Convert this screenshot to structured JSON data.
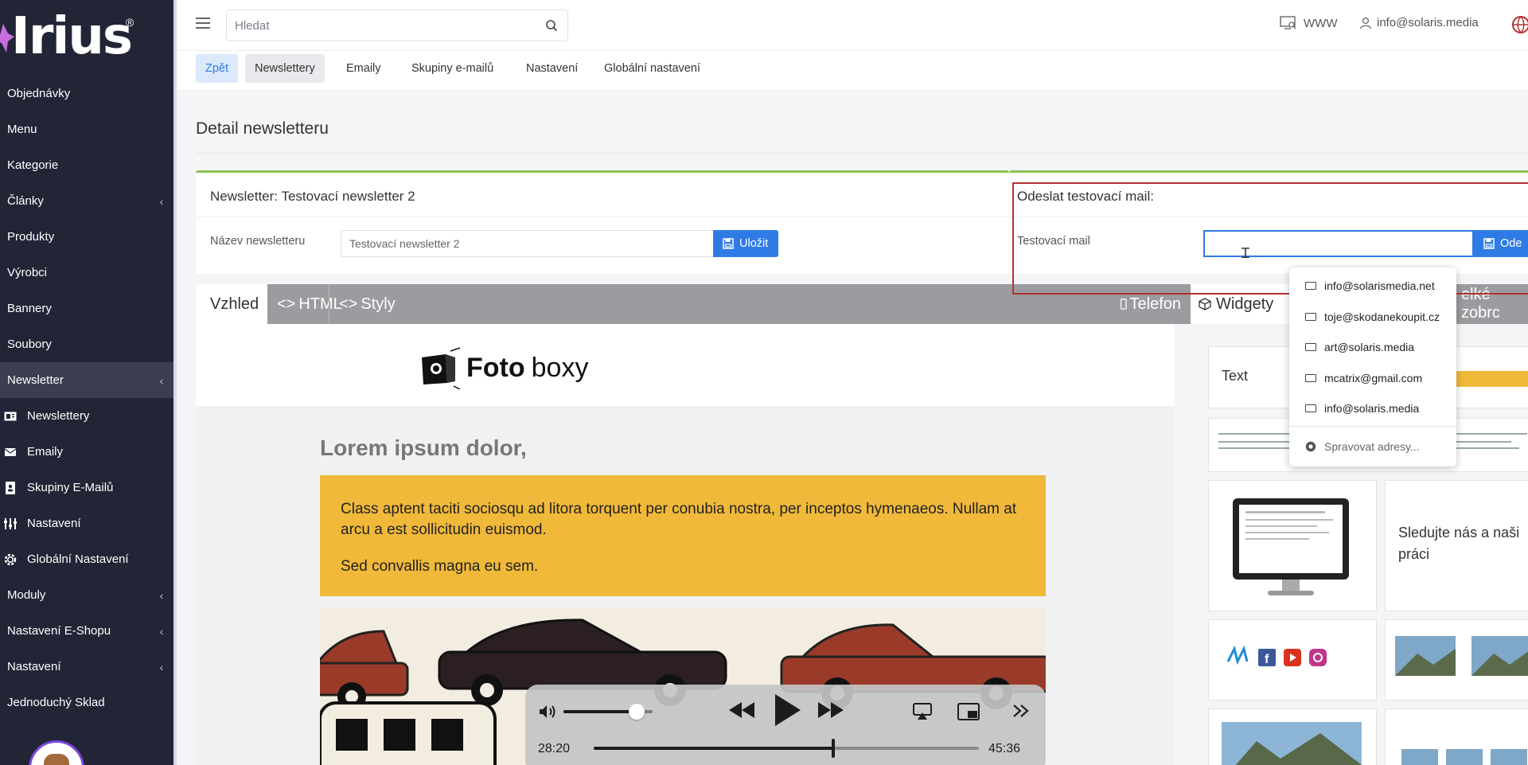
{
  "sidebar": {
    "logo_text": "Irius",
    "logo_mark": "®",
    "items": [
      {
        "label": "Objednávky",
        "chevron": false
      },
      {
        "label": "Menu",
        "chevron": false
      },
      {
        "label": "Kategorie",
        "chevron": false
      },
      {
        "label": "Články",
        "chevron": true
      },
      {
        "label": "Produkty",
        "chevron": false
      },
      {
        "label": "Výrobci",
        "chevron": false
      },
      {
        "label": "Bannery",
        "chevron": false
      },
      {
        "label": "Soubory",
        "chevron": false
      },
      {
        "label": "Newsletter",
        "chevron": true,
        "active": true
      }
    ],
    "sub_items": [
      {
        "label": "Newslettery",
        "icon": "newsletter-icon"
      },
      {
        "label": "Emaily",
        "icon": "email-icon"
      },
      {
        "label": "Skupiny E-Mailů",
        "icon": "contacts-icon"
      },
      {
        "label": "Nastavení",
        "icon": "sliders-icon"
      },
      {
        "label": "Globální Nastavení",
        "icon": "gear-icon"
      }
    ],
    "items_after": [
      {
        "label": "Moduly",
        "chevron": true
      },
      {
        "label": "Nastavení E-Shopu",
        "chevron": true
      },
      {
        "label": "Nastavení",
        "chevron": true
      },
      {
        "label": "Jednoduchý Sklad",
        "chevron": false
      }
    ],
    "chevron_glyph": "‹"
  },
  "topbar": {
    "search_placeholder": "Hledat",
    "www_label": "WWW",
    "user_email": "info@solaris.media"
  },
  "subnav": {
    "tabs": [
      "Zpět",
      "Newslettery",
      "Emaily",
      "Skupiny e-mailů",
      "Nastavení",
      "Globální nastavení"
    ]
  },
  "page": {
    "title": "Detail newsletteru",
    "newsletter_card": {
      "heading": "Newsletter: Testovací newsletter 2",
      "name_label": "Název newsletteru",
      "name_value": "Testovací newsletter 2",
      "save_label": "Uložit"
    },
    "test_card": {
      "heading": "Odeslat testovací mail:",
      "mail_label": "Testovací mail",
      "mail_value": "",
      "send_label": "Ode"
    }
  },
  "editor": {
    "tabs": [
      "Vzhled",
      "HTML",
      "Styly"
    ],
    "device_label": "Telefon",
    "widgets_tab": "Widgety",
    "big_preview_label": "elké zobrc"
  },
  "preview": {
    "logo_bold": "Foto",
    "logo_light": "boxy",
    "heading": "Lorem ipsum dolor,",
    "paragraph1": "Class aptent taciti sociosqu ad litora torquent per conubia nostra, per inceptos hymenaeos. Nullam at arcu a est sollicitudin euismod.",
    "paragraph2": "Sed convallis magna eu sem."
  },
  "widgets": {
    "text_label": "Text",
    "follow_text": "Sledujte nás a naši práci"
  },
  "autocomplete": {
    "suggestions": [
      "info@solarismedia.net",
      "toje@skodanekoupit.cz",
      "art@solaris.media",
      "mcatrix@gmail.com",
      "info@solaris.media"
    ],
    "manage_label": "Spravovat adresy..."
  },
  "player": {
    "elapsed": "28:20",
    "total": "45:36",
    "progress_fraction": 0.621,
    "volume_fraction": 0.82
  },
  "colors": {
    "sidebar_bg": "#222536",
    "accent_blue": "#2f7be5",
    "card_top_green": "#8cc152",
    "highlight_red": "#b3312f",
    "yellow_block": "#f0b93a"
  }
}
